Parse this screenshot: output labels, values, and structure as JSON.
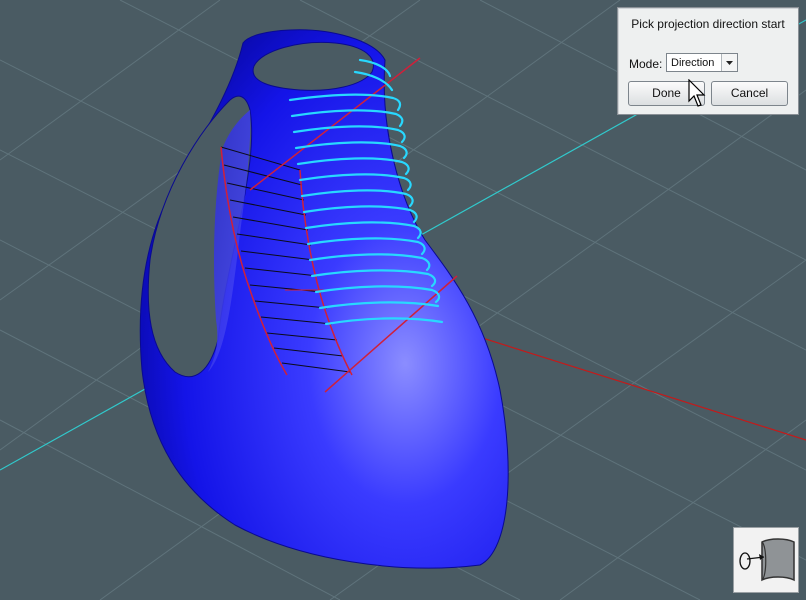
{
  "dialog": {
    "title": "Pick projection direction start",
    "mode_label": "Mode:",
    "mode_value": "Direction",
    "done_label": "Done",
    "cancel_label": "Cancel"
  },
  "icons": {
    "dropdown": "chevron-down-icon",
    "cursor": "mouse-pointer-icon",
    "tool": "project-curve-icon"
  },
  "colors": {
    "background": "#4a5b63",
    "surface": "#1a1aff",
    "curves": "#22d4ff",
    "axis_x": "#d01818",
    "axis_y": "#2fd0d0",
    "grid": "#5d7078"
  }
}
